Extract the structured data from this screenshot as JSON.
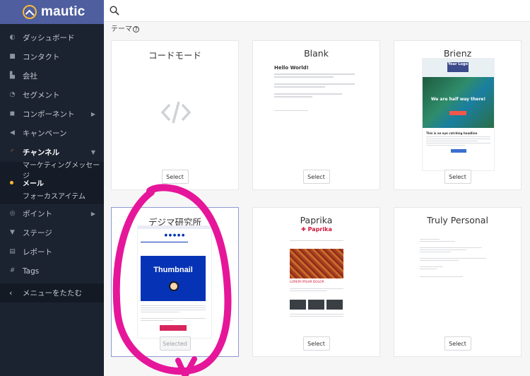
{
  "app": {
    "name": "mautic"
  },
  "sidebar": {
    "items": [
      {
        "label": "ダッシュボード",
        "icon": "dashboard-icon"
      },
      {
        "label": "コンタクト",
        "icon": "contacts-icon"
      },
      {
        "label": "会社",
        "icon": "building-icon"
      },
      {
        "label": "セグメント",
        "icon": "pie-chart-icon"
      },
      {
        "label": "コンポーネント",
        "icon": "puzzle-icon",
        "has_children": true
      },
      {
        "label": "キャンペーン",
        "icon": "megaphone-icon"
      },
      {
        "label": "チャンネル",
        "icon": "rss-icon",
        "expanded": true
      },
      {
        "label": "ポイント",
        "icon": "points-icon",
        "has_children": true
      },
      {
        "label": "ステージ",
        "icon": "filter-icon"
      },
      {
        "label": "レポート",
        "icon": "report-icon"
      },
      {
        "label": "Tags",
        "icon": "hash-icon"
      }
    ],
    "channel_sub": [
      {
        "label": "マーケティングメッセージ"
      },
      {
        "label": "メール",
        "current": true
      },
      {
        "label": "フォーカスアイテム"
      }
    ],
    "collapse_label": "メニューをたたむ"
  },
  "content": {
    "section_label": "テーマ",
    "themes": [
      {
        "title": "コードモード",
        "button": "Select"
      },
      {
        "title": "Blank",
        "button": "Select",
        "heading": "Hello World!"
      },
      {
        "title": "Brienz",
        "button": "Select",
        "logo": "Your Logo",
        "hero": "We are half way there!",
        "body_heading": "This is an eye catching headline"
      },
      {
        "title": "デジマ研究所",
        "button": "Selected",
        "hero": "Thumbnail",
        "selected": true
      },
      {
        "title": "Paprika",
        "button": "Select",
        "logo": "Paprika",
        "caption": "LOREM IPSUM DOLOR"
      },
      {
        "title": "Truly Personal",
        "button": "Select"
      }
    ]
  },
  "colors": {
    "sidebar_bg": "#1c2330",
    "logo_bar": "#4e5e9e",
    "accent_orange": "#f7931e",
    "annotation_pink": "#e6169a"
  }
}
